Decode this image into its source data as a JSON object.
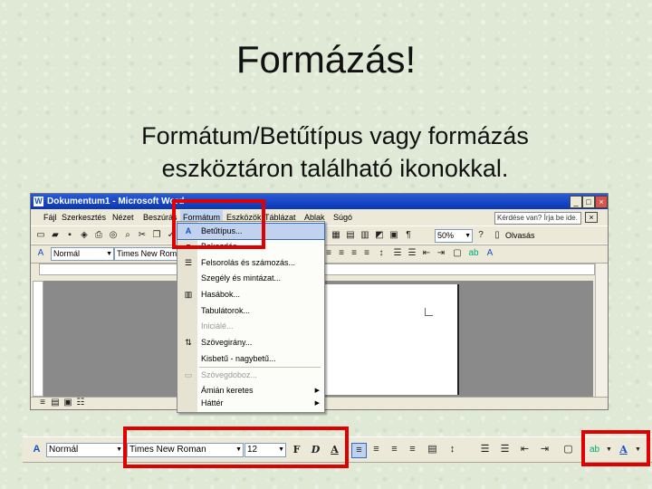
{
  "slide": {
    "title": "Formázás!",
    "body_line1": "Formátum/Betűtípus vagy formázás",
    "body_line2": "eszköztáron található ikonokkal."
  },
  "window": {
    "title": "Dokumentum1 - Microsoft Word",
    "help_placeholder": "Kérdése van? Írja be ide."
  },
  "menubar": {
    "items": [
      "Fájl",
      "Szerkesztés",
      "Nézet",
      "Beszúrás",
      "Formátum",
      "Eszközök",
      "Táblázat",
      "Ablak",
      "Súgó"
    ]
  },
  "standard_toolbar": {
    "zoom": "50%",
    "read_label": "Olvasás"
  },
  "formatting_toolbar": {
    "style": "Normál",
    "font": "Times New Roman"
  },
  "format_menu": {
    "items": [
      {
        "label": "Betűtípus...",
        "state": "selected"
      },
      {
        "label": "Bekezdés...",
        "state": "normal"
      },
      {
        "label": "Felsorolás és számozás...",
        "state": "normal"
      },
      {
        "label": "Szegély és mintázat...",
        "state": "normal"
      },
      {
        "label": "Hasábok...",
        "state": "normal"
      },
      {
        "label": "Tabulátorok...",
        "state": "normal"
      },
      {
        "label": "Iniciálé...",
        "state": "disabled"
      },
      {
        "label": "Szövegirány...",
        "state": "normal"
      },
      {
        "label": "Kisbetű - nagybetű...",
        "state": "normal"
      },
      {
        "label": "Szövegdoboz...",
        "state": "disabled"
      },
      {
        "label": "Ámián keretes",
        "state": "normal"
      },
      {
        "label": "Háttér",
        "state": "normal"
      }
    ],
    "more_arrow": "⌄"
  },
  "bottom_toolbar": {
    "style": "Normál",
    "font": "Times New Roman",
    "size": "12",
    "bold": "F",
    "italic": "D",
    "underline": "A"
  },
  "colors": {
    "highlight": "#e00000",
    "titlebar": "#0a36b4",
    "menu_selected": "#c1d2ee"
  }
}
